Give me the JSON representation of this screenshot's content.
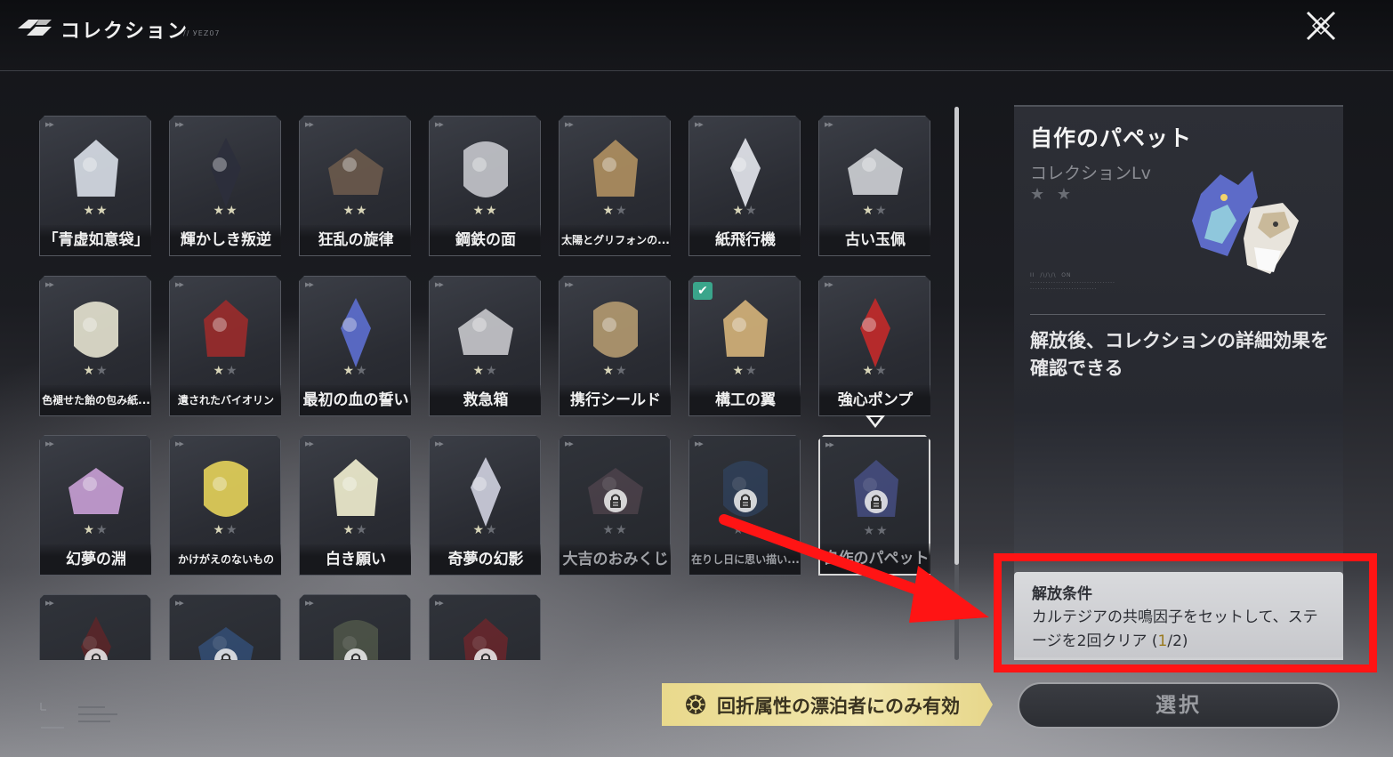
{
  "header": {
    "title": "コレクション",
    "subtitle": "// УЕZ07"
  },
  "cards": [
    {
      "name": "「青虚如意袋」",
      "stars_on": 2,
      "stars_off": 0,
      "locked": false,
      "checked": false,
      "small": false
    },
    {
      "name": "輝かしき叛逆",
      "stars_on": 2,
      "stars_off": 0,
      "locked": false,
      "checked": false,
      "small": false
    },
    {
      "name": "狂乱の旋律",
      "stars_on": 2,
      "stars_off": 0,
      "locked": false,
      "checked": false,
      "small": false
    },
    {
      "name": "鋼鉄の面",
      "stars_on": 2,
      "stars_off": 0,
      "locked": false,
      "checked": false,
      "small": false
    },
    {
      "name": "太陽とグリフォンの...",
      "stars_on": 1,
      "stars_off": 1,
      "locked": false,
      "checked": false,
      "small": true
    },
    {
      "name": "紙飛行機",
      "stars_on": 1,
      "stars_off": 1,
      "locked": false,
      "checked": false,
      "small": false
    },
    {
      "name": "古い玉佩",
      "stars_on": 1,
      "stars_off": 1,
      "locked": false,
      "checked": false,
      "small": false
    },
    {
      "name": "色褪せた飴の包み紙...",
      "stars_on": 1,
      "stars_off": 1,
      "locked": false,
      "checked": false,
      "small": true
    },
    {
      "name": "遺されたバイオリン",
      "stars_on": 1,
      "stars_off": 1,
      "locked": false,
      "checked": false,
      "small": true
    },
    {
      "name": "最初の血の誓い",
      "stars_on": 1,
      "stars_off": 1,
      "locked": false,
      "checked": false,
      "small": false
    },
    {
      "name": "救急箱",
      "stars_on": 1,
      "stars_off": 1,
      "locked": false,
      "checked": false,
      "small": false
    },
    {
      "name": "携行シールド",
      "stars_on": 1,
      "stars_off": 1,
      "locked": false,
      "checked": false,
      "small": false
    },
    {
      "name": "構工の翼",
      "stars_on": 1,
      "stars_off": 1,
      "locked": false,
      "checked": true,
      "small": false
    },
    {
      "name": "強心ポンプ",
      "stars_on": 1,
      "stars_off": 1,
      "locked": false,
      "checked": false,
      "small": false
    },
    {
      "name": "幻夢の淵",
      "stars_on": 1,
      "stars_off": 1,
      "locked": false,
      "checked": false,
      "small": false
    },
    {
      "name": "かけがえのないもの",
      "stars_on": 1,
      "stars_off": 1,
      "locked": false,
      "checked": false,
      "small": true
    },
    {
      "name": "白き願い",
      "stars_on": 1,
      "stars_off": 1,
      "locked": false,
      "checked": false,
      "small": false
    },
    {
      "name": "奇夢の幻影",
      "stars_on": 1,
      "stars_off": 1,
      "locked": false,
      "checked": false,
      "small": false
    },
    {
      "name": "大吉のおみくじ",
      "stars_on": 0,
      "stars_off": 2,
      "locked": true,
      "checked": false,
      "small": false
    },
    {
      "name": "在りし日に思い描い...",
      "stars_on": 0,
      "stars_off": 2,
      "locked": true,
      "checked": false,
      "small": true
    },
    {
      "name": "自作のパペット",
      "stars_on": 0,
      "stars_off": 2,
      "locked": true,
      "checked": false,
      "small": false,
      "selected": true
    },
    {
      "name": "",
      "stars_on": 0,
      "stars_off": 0,
      "locked": true,
      "checked": false,
      "small": false
    },
    {
      "name": "",
      "stars_on": 0,
      "stars_off": 0,
      "locked": true,
      "checked": false,
      "small": false
    },
    {
      "name": "",
      "stars_on": 0,
      "stars_off": 0,
      "locked": true,
      "checked": false,
      "small": false
    },
    {
      "name": "",
      "stars_on": 0,
      "stars_off": 0,
      "locked": true,
      "checked": false,
      "small": false
    }
  ],
  "card_icons": [
    "pouch-icon",
    "horned-helmet-icon",
    "music-box-icon",
    "steel-mask-icon",
    "scroll-stamp-icon",
    "paper-plane-icon",
    "jade-pendant-icon",
    "candy-wrapper-icon",
    "violin-icon",
    "feather-dagger-icon",
    "first-aid-kit-icon",
    "hex-shield-icon",
    "mechanical-wing-icon",
    "heart-pump-icon",
    "crystal-ball-icon",
    "necklace-icon",
    "white-flowers-icon",
    "phantom-fox-icon",
    "omikuji-icon",
    "picture-book-icon",
    "puppet-icon",
    "red-ornament-icon",
    "blue-ornament-icon",
    "green-ornament-icon",
    "red-ornament-icon"
  ],
  "detail": {
    "name": "自作のパペット",
    "level_label": "コレクションLv",
    "stars": "★ ★",
    "fine_print": "II  /\\/\\/\\  ON\n.................................\n..........................",
    "description": "解放後、コレクションの詳細効果を確認できる",
    "icon": "puppet-icon"
  },
  "condition": {
    "title": "解放条件",
    "text": "カルテジアの共鳴因子をセットして、ステージを2回クリア (",
    "count": "1",
    "total": "/2)"
  },
  "attribute_banner": {
    "text": "回折属性の漂泊者にのみ有効",
    "icon": "spectro-icon"
  },
  "select_button": {
    "label": "選択"
  },
  "colors": {
    "highlight_red": "#ff1414",
    "banner_gold": "#e9d98c",
    "check_teal": "#3aa58b"
  }
}
